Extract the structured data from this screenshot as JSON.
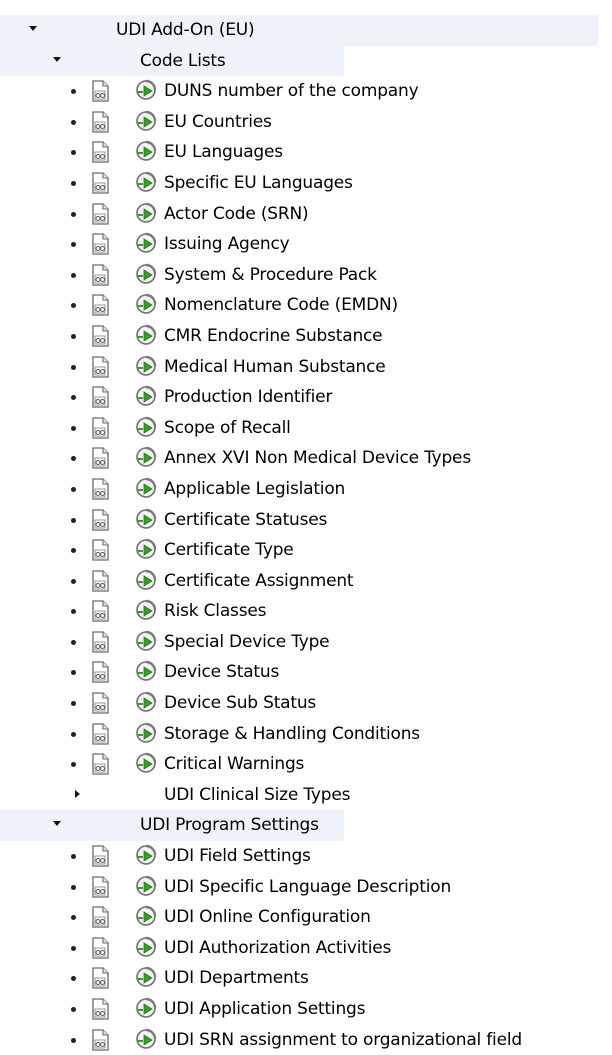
{
  "tree": {
    "root": {
      "label": "UDI Add-On (EU)",
      "expanded": true
    },
    "code_lists": {
      "label": "Code Lists",
      "expanded": true,
      "items": [
        "DUNS number of the company",
        "EU Countries",
        "EU Languages",
        "Specific EU Languages",
        "Actor Code (SRN)",
        "Issuing Agency",
        "System & Procedure Pack",
        "Nomenclature Code (EMDN)",
        "CMR Endocrine Substance",
        "Medical Human Substance",
        "Production Identifier",
        "Scope of Recall",
        "Annex XVI Non Medical Device Types",
        "Applicable Legislation",
        "Certificate Statuses",
        "Certificate Type",
        "Certificate Assignment",
        "Risk Classes",
        "Special Device Type",
        "Device Status",
        "Device Sub Status",
        "Storage & Handling Conditions",
        "Critical Warnings"
      ],
      "subfolder": {
        "label": "UDI Clinical Size Types",
        "expanded": false
      }
    },
    "program_settings": {
      "label": "UDI Program Settings",
      "expanded": true,
      "items": [
        "UDI Field Settings",
        "UDI Specific Language Description",
        "UDI Online Configuration",
        "UDI Authorization Activities",
        "UDI Departments",
        "UDI Application Settings",
        "UDI SRN assignment to organizational field"
      ]
    }
  },
  "icons": {
    "expanded": "triangle-down-icon",
    "collapsed": "triangle-right-icon",
    "leaf_bullet": "bullet-icon",
    "document": "document-icon",
    "execute": "execute-icon"
  },
  "colors": {
    "folder_row_bg": "#edf3f8",
    "doc_icon_stroke": "#6b6b6b",
    "exec_icon_green": "#3a9a2c"
  }
}
